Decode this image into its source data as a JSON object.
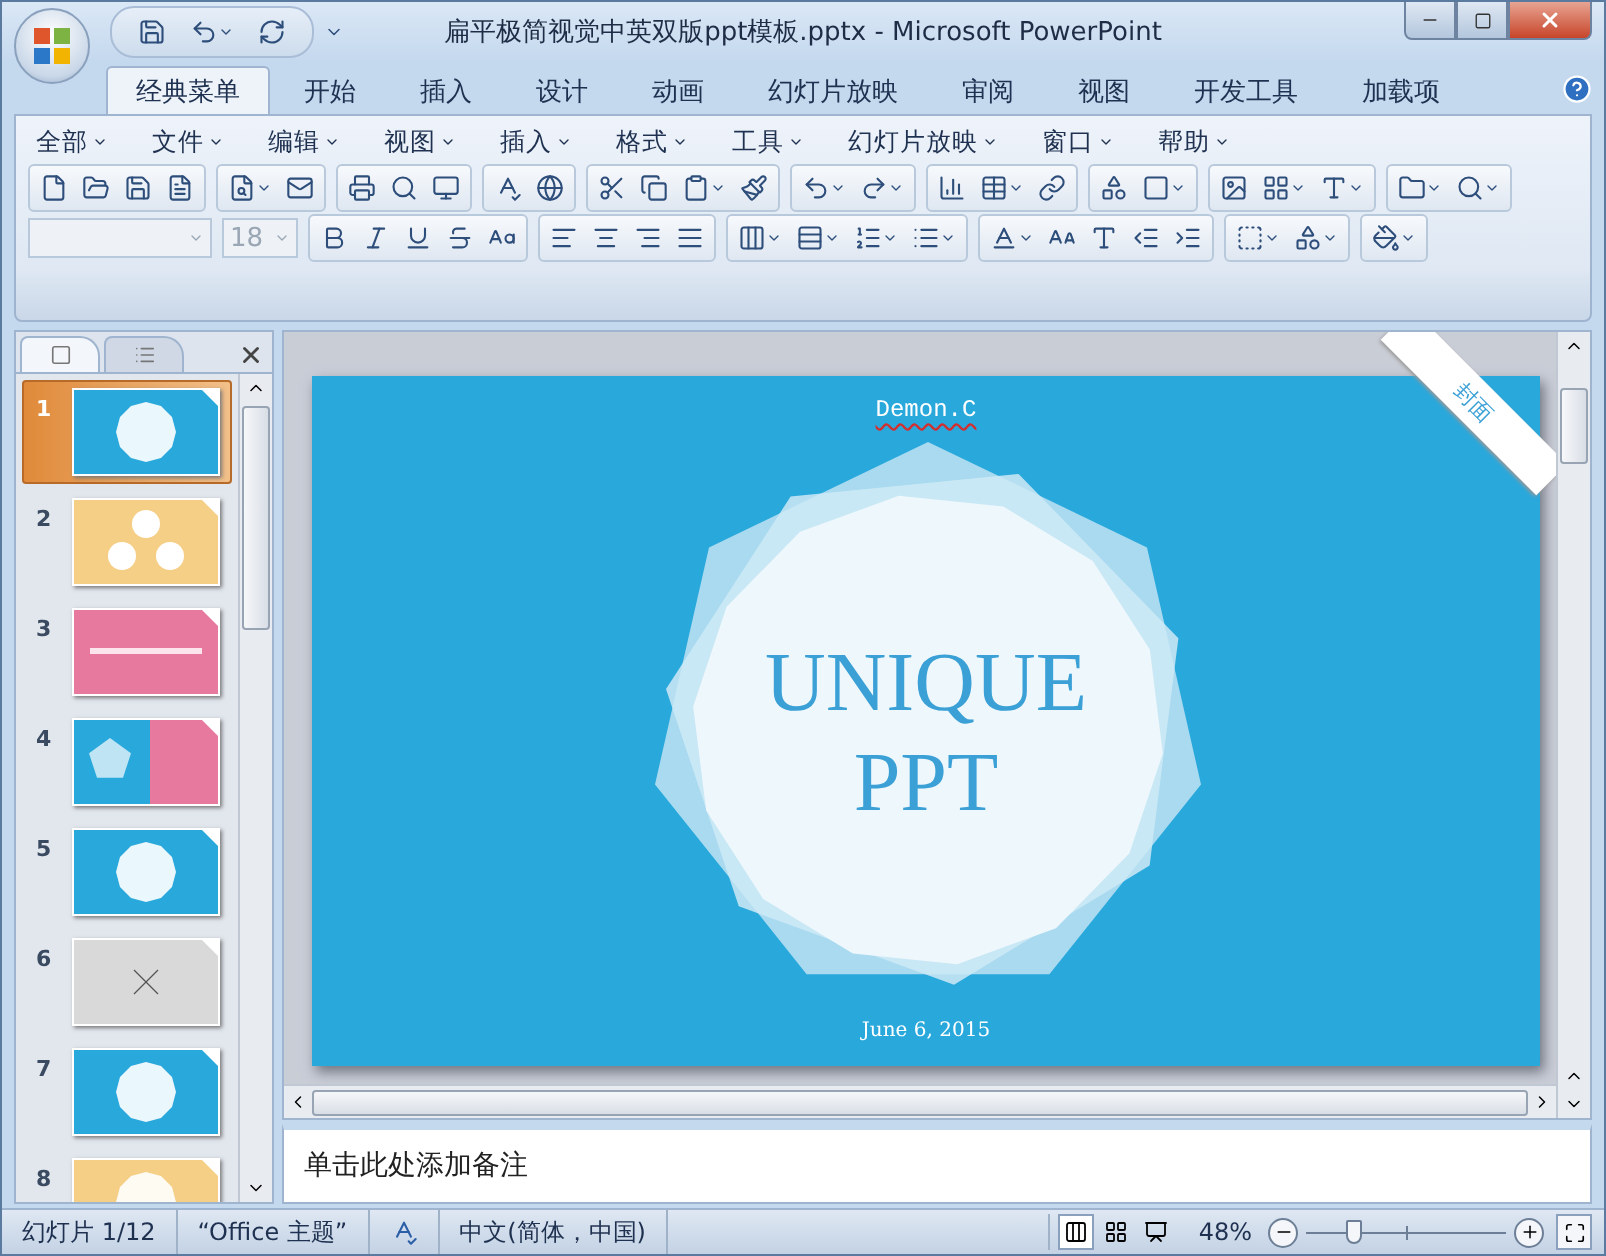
{
  "window": {
    "title": "扁平极简视觉中英双版ppt模板.pptx - Microsoft PowerPoint"
  },
  "tabs": [
    {
      "label": "经典菜单",
      "selected": true
    },
    {
      "label": "开始",
      "selected": false
    },
    {
      "label": "插入",
      "selected": false
    },
    {
      "label": "设计",
      "selected": false
    },
    {
      "label": "动画",
      "selected": false
    },
    {
      "label": "幻灯片放映",
      "selected": false
    },
    {
      "label": "审阅",
      "selected": false
    },
    {
      "label": "视图",
      "selected": false
    },
    {
      "label": "开发工具",
      "selected": false
    },
    {
      "label": "加载项",
      "selected": false
    }
  ],
  "menus": [
    "全部",
    "文件",
    "编辑",
    "视图",
    "插入",
    "格式",
    "工具",
    "幻灯片放映",
    "窗口",
    "帮助"
  ],
  "font_size": {
    "value": "18"
  },
  "panel_tabs": [
    {
      "kind": "slides",
      "selected": true
    },
    {
      "kind": "outline",
      "selected": false
    }
  ],
  "slides": [
    {
      "number": "1",
      "selected": true,
      "color": "#29a8dc"
    },
    {
      "number": "2",
      "selected": false,
      "color": "#f5cf85"
    },
    {
      "number": "3",
      "selected": false,
      "color": "#e8799e"
    },
    {
      "number": "4",
      "selected": false,
      "color": "#29a8dc"
    },
    {
      "number": "5",
      "selected": false,
      "color": "#29a8dc"
    },
    {
      "number": "6",
      "selected": false,
      "color": "#d9d9d9"
    },
    {
      "number": "7",
      "selected": false,
      "color": "#29a8dc"
    },
    {
      "number": "8",
      "selected": false,
      "color": "#f5cf85"
    }
  ],
  "slide": {
    "author": "Demon.C",
    "title_lines": [
      "UNIQUE",
      "PPT"
    ],
    "date": "June 6, 2015",
    "corner_label": "封面"
  },
  "notes": {
    "text": "单击此处添加备注"
  },
  "status_bar": {
    "slide": "幻灯片 1/12",
    "theme": "“Office 主题”",
    "language": "中文(简体，中国)",
    "zoom": "48%",
    "zoom_slider": {
      "level": 0.24
    }
  }
}
